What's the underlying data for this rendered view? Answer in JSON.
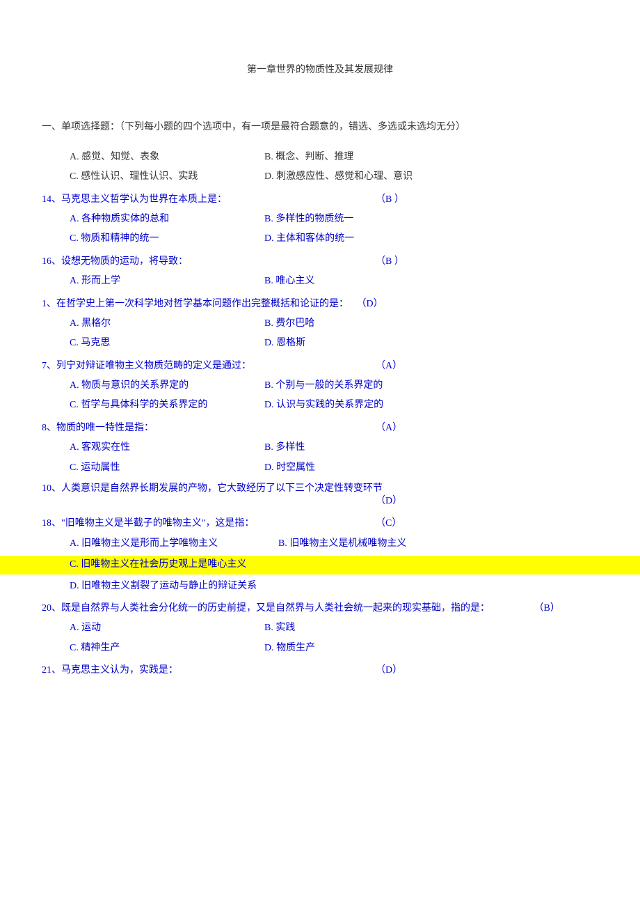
{
  "title": "第一章世界的物质性及其发展规律",
  "section_heading": "一、单项选择题：（下列每小题的四个选项中，有一项是最符合题意的，错选、多选或未选均无分）",
  "block1": {
    "optA": "A. 感觉、知觉、表象",
    "optB": "B. 概念、判断、推理",
    "optC": "C. 感性认识、理性认识、实践",
    "optD": "D. 刺激感应性、感觉和心理、意识"
  },
  "q14": {
    "text": "14、马克思主义哲学认为世界在本质上是：",
    "ans": "（B ）",
    "optA": "A. 各种物质实体的总和",
    "optB": "B. 多样性的物质统一",
    "optC": "C. 物质和精神的统一",
    "optD": "D. 主体和客体的统一"
  },
  "q16": {
    "text": "16、设想无物质的运动，将导致：",
    "ans": "（B ）",
    "optA": "A. 形而上学",
    "optB": "B. 唯心主义"
  },
  "q1": {
    "text": "1、在哲学史上第一次科学地对哲学基本问题作出完整概括和论证的是：",
    "ans": "（D）",
    "optA": "A. 黑格尔",
    "optB": "B. 费尔巴哈",
    "optC": "C. 马克思",
    "optD": "D. 恩格斯"
  },
  "q7": {
    "text": "7、列宁对辩证唯物主义物质范畴的定义是通过：",
    "ans": "（A）",
    "optA": "A. 物质与意识的关系界定的",
    "optB": "B. 个别与一般的关系界定的",
    "optC": "C. 哲学与具体科学的关系界定的",
    "optD": "D. 认识与实践的关系界定的"
  },
  "q8": {
    "text": "8、物质的唯一特性是指：",
    "ans": "（A）",
    "optA": "A. 客观实在性",
    "optB": "B. 多样性",
    "optC": "C. 运动属性",
    "optD": "D. 时空属性"
  },
  "cutoff_line": "10、人类意识是自然界长期发展的产物，它大致经历了以下三个决定性转变环节",
  "cutoff_ans": "（D）",
  "q18": {
    "text": "18、\"旧唯物主义是半截子的唯物主义\"，这是指：",
    "ans": "（C）",
    "optA": "A. 旧唯物主义是形而上学唯物主义",
    "optB": "B. 旧唯物主义是机械唯物主义",
    "optC": "C. 旧唯物主义在社会历史观上是唯心主义",
    "optD": "D. 旧唯物主义割裂了运动与静止的辩证关系"
  },
  "q20": {
    "text": "20、既是自然界与人类社会分化统一的历史前提，又是自然界与人类社会统一起来的现实基础，指的是：",
    "ans": "（B）",
    "optA": "A. 运动",
    "optB": "B. 实践",
    "optC": "C. 精神生产",
    "optD": "D. 物质生产"
  },
  "q21": {
    "text": "21、马克思主义认为，实践是：",
    "ans": "（D）"
  }
}
